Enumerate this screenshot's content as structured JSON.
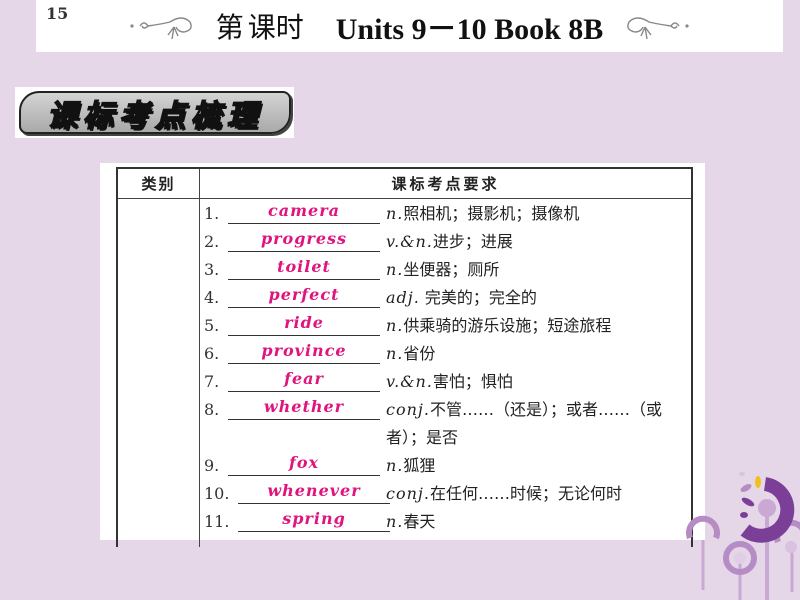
{
  "header": {
    "lesson_prefix": "第",
    "lesson_number": "15",
    "lesson_suffix": "课时",
    "units": "Units 9－10 Book 8B"
  },
  "section_badge": "课标考点梳理",
  "table": {
    "headers": {
      "category": "类别",
      "requirements": "课标考点要求"
    },
    "category_value": "",
    "rows": [
      {
        "num": "1.",
        "answer": "camera",
        "pos": "n.",
        "meaning": "照相机；摄影机；摄像机"
      },
      {
        "num": "2.",
        "answer": "progress",
        "pos": "v.&n.",
        "meaning": "进步；进展"
      },
      {
        "num": "3.",
        "answer": "toilet",
        "pos": "n.",
        "meaning": "坐便器；厕所"
      },
      {
        "num": "4.",
        "answer": "perfect",
        "pos": "adj.",
        "meaning": " 完美的；完全的"
      },
      {
        "num": "5.",
        "answer": "ride",
        "pos": "n.",
        "meaning": "供乘骑的游乐设施；短途旅程"
      },
      {
        "num": "6.",
        "answer": "province",
        "pos": "n.",
        "meaning": "省份"
      },
      {
        "num": "7.",
        "answer": "fear",
        "pos": "v.&n.",
        "meaning": "害怕；惧怕"
      },
      {
        "num": "8.",
        "answer": "whether",
        "pos": "conj.",
        "meaning": "不管……（还是）；或者……（或者）；是否"
      },
      {
        "num": "9.",
        "answer": "fox",
        "pos": "n.",
        "meaning": "狐狸"
      },
      {
        "num": "10.",
        "answer": "whenever",
        "pos": "conj.",
        "meaning": "在任何……时候；无论何时"
      },
      {
        "num": "11.",
        "answer": "spring",
        "pos": "n.",
        "meaning": "春天"
      }
    ]
  },
  "colors": {
    "background": "#e5d6e8",
    "answer": "#e0147e",
    "decoration_purple": "#7b3f98"
  }
}
